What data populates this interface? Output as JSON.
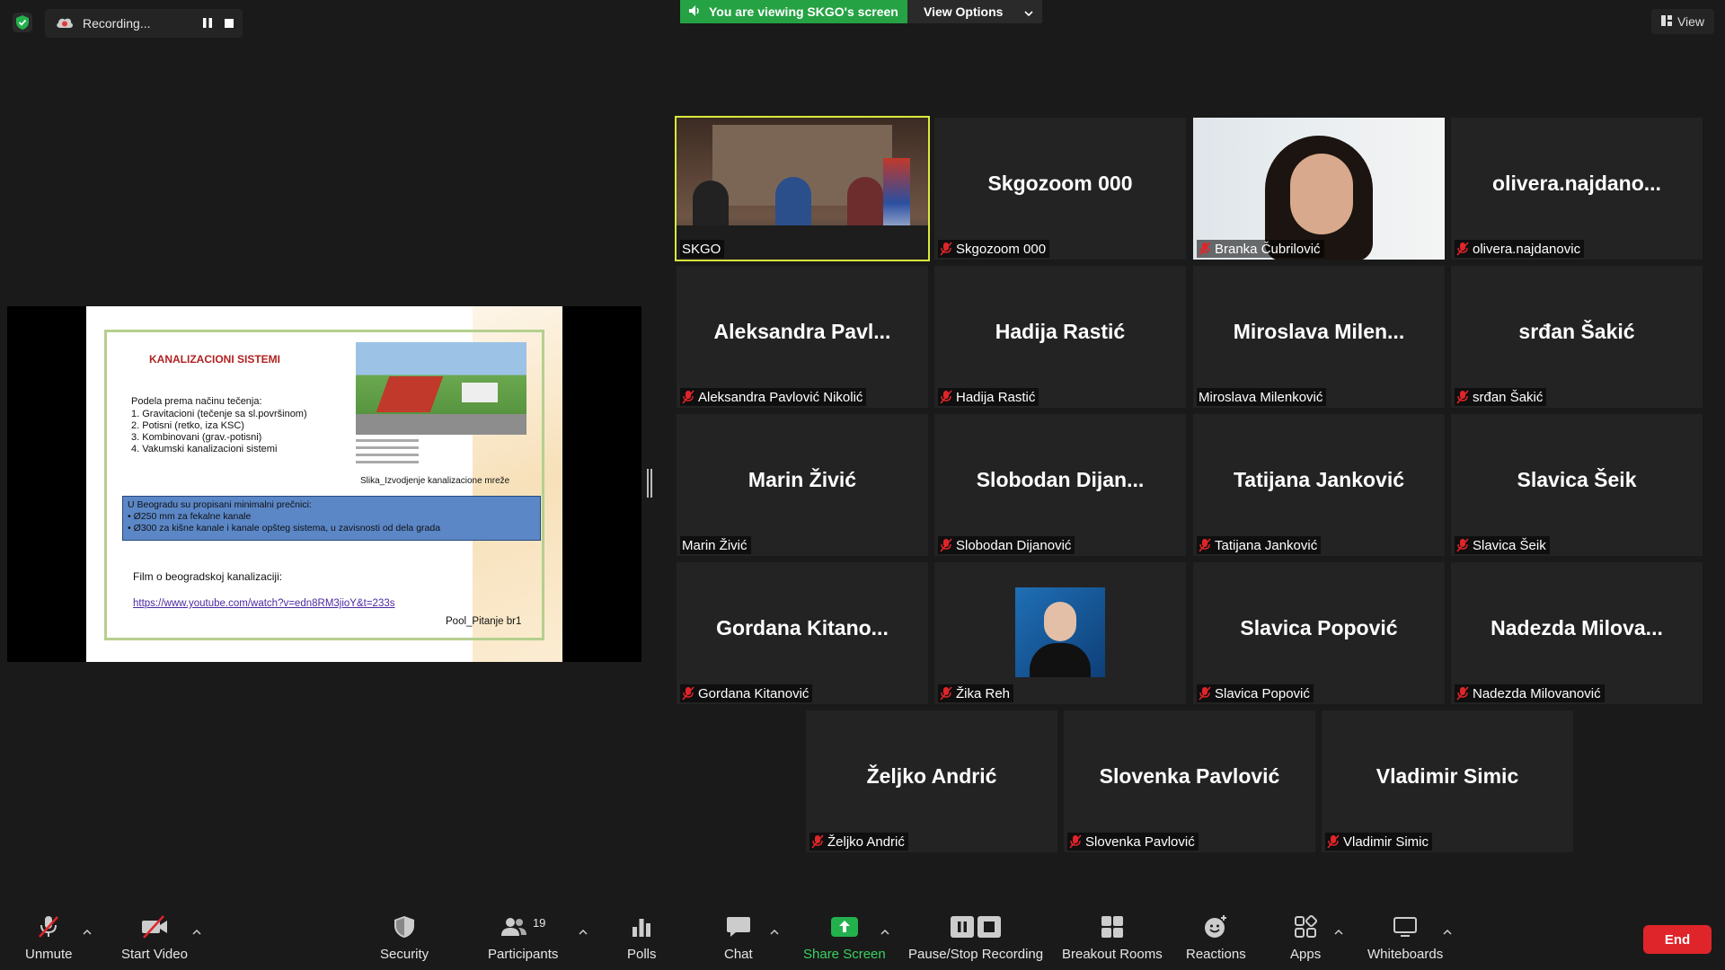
{
  "top": {
    "recording_label": "Recording...",
    "viewing_label": "You are viewing SKGO's screen",
    "view_options_label": "View Options",
    "view_label": "View"
  },
  "slide": {
    "title": "KANALIZACIONI SISTEMI",
    "intro": "Podela prema načinu tečenja:",
    "items": [
      "1.   Gravitacioni (tečenje sa sl.površinom)",
      "2.   Potisni (retko, iza KSC)",
      "3.   Kombinovani (grav.-potisni)",
      "4.   Vakumski kanalizacioni sistemi"
    ],
    "caption": "Slika_Izvodjenje kanalizacione mreže",
    "box_lines": [
      "U Beogradu su propisani minimalni prečnici:",
      "• Ø250 mm za fekalne kanale",
      "• Ø300 za kišne kanale i kanale opšteg sistema, u zavisnosti od dela grada"
    ],
    "film_label": "Film o beogradskoj kanalizaciji:",
    "link": "https://www.youtube.com/watch?v=edn8RM3jioY&t=233s",
    "pool": "Pool_Pitanje br1"
  },
  "tiles": [
    {
      "big": "",
      "name": "SKGO",
      "muted": false
    },
    {
      "big": "Skgozoom 000",
      "name": "Skgozoom 000",
      "muted": true
    },
    {
      "big": "",
      "name": "Branka Čubrilović",
      "muted": true
    },
    {
      "big": "olivera.najdano...",
      "name": "olivera.najdanovic",
      "muted": true
    },
    {
      "big": "Aleksandra  Pavl...",
      "name": "Aleksandra Pavlović Nikolić",
      "muted": true
    },
    {
      "big": "Hadija Rastić",
      "name": "Hadija Rastić",
      "muted": true
    },
    {
      "big": "Miroslava  Milen...",
      "name": "Miroslava Milenković",
      "muted": false
    },
    {
      "big": "srđan Šakić",
      "name": "srđan Šakić",
      "muted": true
    },
    {
      "big": "Marin Živić",
      "name": "Marin Živić",
      "muted": false
    },
    {
      "big": "Slobodan  Dijan...",
      "name": "Slobodan Dijanović",
      "muted": true
    },
    {
      "big": "Tatijana Janković",
      "name": "Tatijana Janković",
      "muted": true
    },
    {
      "big": "Slavica Šeik",
      "name": "Slavica Šeik",
      "muted": true
    },
    {
      "big": "Gordana  Kitano...",
      "name": "Gordana Kitanović",
      "muted": true
    },
    {
      "big": "",
      "name": "Žika Reh",
      "muted": true
    },
    {
      "big": "Slavica Popović",
      "name": "Slavica Popović",
      "muted": true
    },
    {
      "big": "Nadezda  Milova...",
      "name": "Nadezda Milovanović",
      "muted": true
    },
    {
      "big": "Željko Andrić",
      "name": "Željko Andrić",
      "muted": true
    },
    {
      "big": "Slovenka Pavlović",
      "name": "Slovenka Pavlović",
      "muted": true
    },
    {
      "big": "Vladimir Simic",
      "name": "Vladimir Simic",
      "muted": true
    }
  ],
  "toolbar": {
    "unmute": "Unmute",
    "start_video": "Start Video",
    "security": "Security",
    "participants": "Participants",
    "participants_count": "19",
    "polls": "Polls",
    "chat": "Chat",
    "share_screen": "Share Screen",
    "pause_stop": "Pause/Stop Recording",
    "breakout": "Breakout Rooms",
    "reactions": "Reactions",
    "apps": "Apps",
    "whiteboards": "Whiteboards",
    "end": "End"
  },
  "colors": {
    "accent_green": "#25a244",
    "active_speaker": "#d9ea3c",
    "end_red": "#e0252a",
    "muted_red": "#e0252a"
  }
}
